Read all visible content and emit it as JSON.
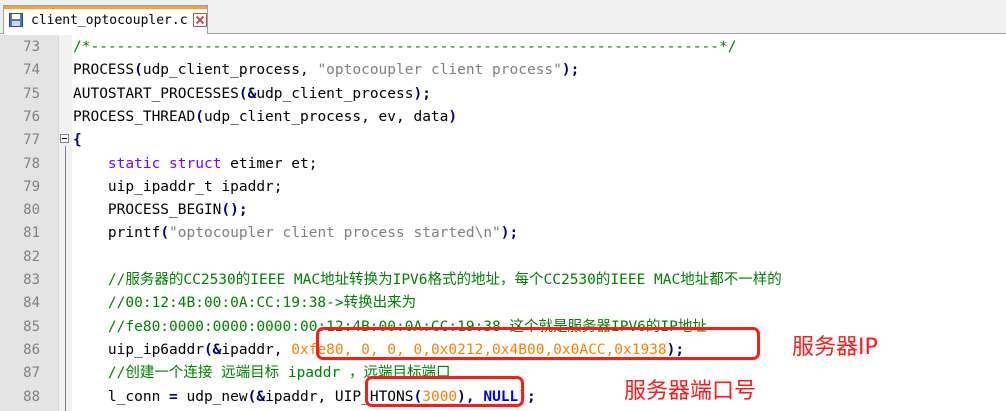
{
  "tab": {
    "filename": "client_optocoupler.c"
  },
  "lines": [
    {
      "n": "73",
      "segs": [
        {
          "t": "/*------------------------------------------------------------------------*/",
          "c": "cm"
        }
      ]
    },
    {
      "n": "74",
      "segs": [
        {
          "t": "PROCESS",
          "c": ""
        },
        {
          "t": "(",
          "c": "op"
        },
        {
          "t": "udp_client_process, ",
          "c": ""
        },
        {
          "t": "\"optocoupler client process\"",
          "c": "str"
        },
        {
          "t": ");",
          "c": "op"
        }
      ]
    },
    {
      "n": "75",
      "segs": [
        {
          "t": "AUTOSTART_PROCESSES",
          "c": ""
        },
        {
          "t": "(&",
          "c": "op"
        },
        {
          "t": "udp_client_process",
          "c": ""
        },
        {
          "t": ");",
          "c": "op"
        }
      ]
    },
    {
      "n": "76",
      "segs": [
        {
          "t": "PROCESS_THREAD",
          "c": ""
        },
        {
          "t": "(",
          "c": "op"
        },
        {
          "t": "udp_client_process, ev, data",
          "c": ""
        },
        {
          "t": ")",
          "c": "op"
        }
      ]
    },
    {
      "n": "77",
      "segs": [
        {
          "t": "{",
          "c": "op"
        }
      ]
    },
    {
      "n": "78",
      "segs": [
        {
          "t": "    ",
          "c": ""
        },
        {
          "t": "static",
          "c": "kw"
        },
        {
          "t": " ",
          "c": ""
        },
        {
          "t": "struct",
          "c": "kw"
        },
        {
          "t": " etimer et;",
          "c": ""
        }
      ]
    },
    {
      "n": "79",
      "segs": [
        {
          "t": "    uip_ipaddr_t ipaddr;",
          "c": ""
        }
      ]
    },
    {
      "n": "80",
      "segs": [
        {
          "t": "    PROCESS_BEGIN",
          "c": ""
        },
        {
          "t": "();",
          "c": "op"
        }
      ]
    },
    {
      "n": "81",
      "segs": [
        {
          "t": "    printf",
          "c": ""
        },
        {
          "t": "(",
          "c": "op"
        },
        {
          "t": "\"optocoupler client process started\\n\"",
          "c": "str"
        },
        {
          "t": ");",
          "c": "op"
        }
      ]
    },
    {
      "n": "82",
      "segs": []
    },
    {
      "n": "83",
      "segs": [
        {
          "t": "    //服务器的CC2530的IEEE MAC地址转换为IPV6格式的地址，每个CC2530的IEEE MAC地址都不一样的",
          "c": "cm"
        }
      ]
    },
    {
      "n": "84",
      "segs": [
        {
          "t": "    //00:12:4B:00:0A:CC:19:38->转换出来为",
          "c": "cm"
        }
      ]
    },
    {
      "n": "85",
      "segs": [
        {
          "t": "    //fe80:0000:0000:0000:00:12:4B:00:0A:CC:19:38 这个就是服务器IPV6的IP地址",
          "c": "cm"
        }
      ]
    },
    {
      "n": "86",
      "segs": [
        {
          "t": "    uip_ip6addr",
          "c": ""
        },
        {
          "t": "(&",
          "c": "op"
        },
        {
          "t": "ipaddr, ",
          "c": ""
        },
        {
          "t": "0xfe80, 0, 0, 0,0x0212,0x4B00,0x0ACC,0x1938",
          "c": "num"
        },
        {
          "t": ");",
          "c": "op"
        }
      ]
    },
    {
      "n": "87",
      "segs": [
        {
          "t": "    //创建一个连接 远端目标 ipaddr ，远端目标端口",
          "c": "cm"
        }
      ]
    },
    {
      "n": "88",
      "segs": [
        {
          "t": "    l_conn ",
          "c": ""
        },
        {
          "t": "=",
          "c": "op"
        },
        {
          "t": " udp_new",
          "c": ""
        },
        {
          "t": "(&",
          "c": "op"
        },
        {
          "t": "ipaddr, ",
          "c": ""
        },
        {
          "t": "UIP_HTONS",
          "c": "mac"
        },
        {
          "t": "(",
          "c": "op"
        },
        {
          "t": "3000",
          "c": "num"
        },
        {
          "t": "), ",
          "c": "op"
        },
        {
          "t": "NULL",
          "c": "nul"
        },
        {
          "t": ");",
          "c": "op"
        }
      ]
    }
  ],
  "annotations": {
    "server_ip": "服务器IP",
    "server_port": "服务器端口号"
  }
}
